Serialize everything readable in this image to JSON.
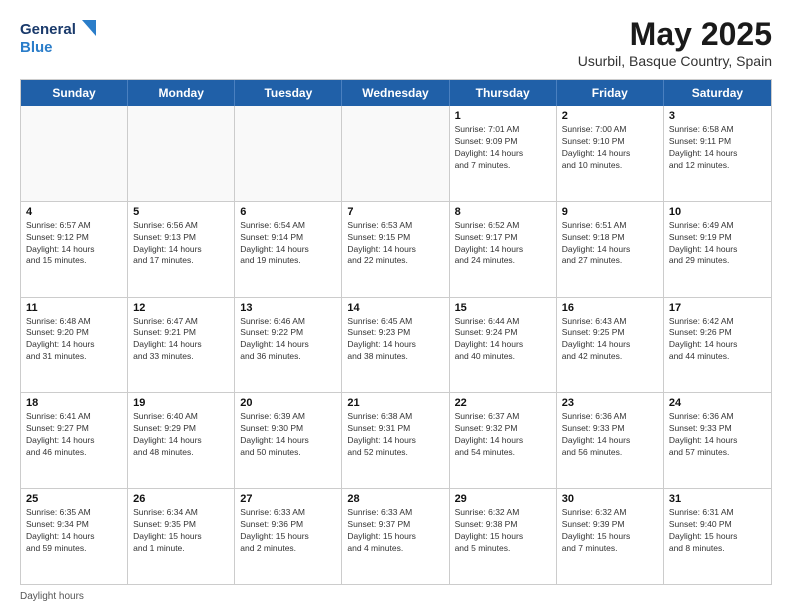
{
  "logo": {
    "line1": "General",
    "line2": "Blue"
  },
  "title": "May 2025",
  "subtitle": "Usurbil, Basque Country, Spain",
  "dayHeaders": [
    "Sunday",
    "Monday",
    "Tuesday",
    "Wednesday",
    "Thursday",
    "Friday",
    "Saturday"
  ],
  "weeks": [
    [
      {
        "num": "",
        "info": ""
      },
      {
        "num": "",
        "info": ""
      },
      {
        "num": "",
        "info": ""
      },
      {
        "num": "",
        "info": ""
      },
      {
        "num": "1",
        "info": "Sunrise: 7:01 AM\nSunset: 9:09 PM\nDaylight: 14 hours\nand 7 minutes."
      },
      {
        "num": "2",
        "info": "Sunrise: 7:00 AM\nSunset: 9:10 PM\nDaylight: 14 hours\nand 10 minutes."
      },
      {
        "num": "3",
        "info": "Sunrise: 6:58 AM\nSunset: 9:11 PM\nDaylight: 14 hours\nand 12 minutes."
      }
    ],
    [
      {
        "num": "4",
        "info": "Sunrise: 6:57 AM\nSunset: 9:12 PM\nDaylight: 14 hours\nand 15 minutes."
      },
      {
        "num": "5",
        "info": "Sunrise: 6:56 AM\nSunset: 9:13 PM\nDaylight: 14 hours\nand 17 minutes."
      },
      {
        "num": "6",
        "info": "Sunrise: 6:54 AM\nSunset: 9:14 PM\nDaylight: 14 hours\nand 19 minutes."
      },
      {
        "num": "7",
        "info": "Sunrise: 6:53 AM\nSunset: 9:15 PM\nDaylight: 14 hours\nand 22 minutes."
      },
      {
        "num": "8",
        "info": "Sunrise: 6:52 AM\nSunset: 9:17 PM\nDaylight: 14 hours\nand 24 minutes."
      },
      {
        "num": "9",
        "info": "Sunrise: 6:51 AM\nSunset: 9:18 PM\nDaylight: 14 hours\nand 27 minutes."
      },
      {
        "num": "10",
        "info": "Sunrise: 6:49 AM\nSunset: 9:19 PM\nDaylight: 14 hours\nand 29 minutes."
      }
    ],
    [
      {
        "num": "11",
        "info": "Sunrise: 6:48 AM\nSunset: 9:20 PM\nDaylight: 14 hours\nand 31 minutes."
      },
      {
        "num": "12",
        "info": "Sunrise: 6:47 AM\nSunset: 9:21 PM\nDaylight: 14 hours\nand 33 minutes."
      },
      {
        "num": "13",
        "info": "Sunrise: 6:46 AM\nSunset: 9:22 PM\nDaylight: 14 hours\nand 36 minutes."
      },
      {
        "num": "14",
        "info": "Sunrise: 6:45 AM\nSunset: 9:23 PM\nDaylight: 14 hours\nand 38 minutes."
      },
      {
        "num": "15",
        "info": "Sunrise: 6:44 AM\nSunset: 9:24 PM\nDaylight: 14 hours\nand 40 minutes."
      },
      {
        "num": "16",
        "info": "Sunrise: 6:43 AM\nSunset: 9:25 PM\nDaylight: 14 hours\nand 42 minutes."
      },
      {
        "num": "17",
        "info": "Sunrise: 6:42 AM\nSunset: 9:26 PM\nDaylight: 14 hours\nand 44 minutes."
      }
    ],
    [
      {
        "num": "18",
        "info": "Sunrise: 6:41 AM\nSunset: 9:27 PM\nDaylight: 14 hours\nand 46 minutes."
      },
      {
        "num": "19",
        "info": "Sunrise: 6:40 AM\nSunset: 9:29 PM\nDaylight: 14 hours\nand 48 minutes."
      },
      {
        "num": "20",
        "info": "Sunrise: 6:39 AM\nSunset: 9:30 PM\nDaylight: 14 hours\nand 50 minutes."
      },
      {
        "num": "21",
        "info": "Sunrise: 6:38 AM\nSunset: 9:31 PM\nDaylight: 14 hours\nand 52 minutes."
      },
      {
        "num": "22",
        "info": "Sunrise: 6:37 AM\nSunset: 9:32 PM\nDaylight: 14 hours\nand 54 minutes."
      },
      {
        "num": "23",
        "info": "Sunrise: 6:36 AM\nSunset: 9:33 PM\nDaylight: 14 hours\nand 56 minutes."
      },
      {
        "num": "24",
        "info": "Sunrise: 6:36 AM\nSunset: 9:33 PM\nDaylight: 14 hours\nand 57 minutes."
      }
    ],
    [
      {
        "num": "25",
        "info": "Sunrise: 6:35 AM\nSunset: 9:34 PM\nDaylight: 14 hours\nand 59 minutes."
      },
      {
        "num": "26",
        "info": "Sunrise: 6:34 AM\nSunset: 9:35 PM\nDaylight: 15 hours\nand 1 minute."
      },
      {
        "num": "27",
        "info": "Sunrise: 6:33 AM\nSunset: 9:36 PM\nDaylight: 15 hours\nand 2 minutes."
      },
      {
        "num": "28",
        "info": "Sunrise: 6:33 AM\nSunset: 9:37 PM\nDaylight: 15 hours\nand 4 minutes."
      },
      {
        "num": "29",
        "info": "Sunrise: 6:32 AM\nSunset: 9:38 PM\nDaylight: 15 hours\nand 5 minutes."
      },
      {
        "num": "30",
        "info": "Sunrise: 6:32 AM\nSunset: 9:39 PM\nDaylight: 15 hours\nand 7 minutes."
      },
      {
        "num": "31",
        "info": "Sunrise: 6:31 AM\nSunset: 9:40 PM\nDaylight: 15 hours\nand 8 minutes."
      }
    ]
  ],
  "footer": "Daylight hours"
}
